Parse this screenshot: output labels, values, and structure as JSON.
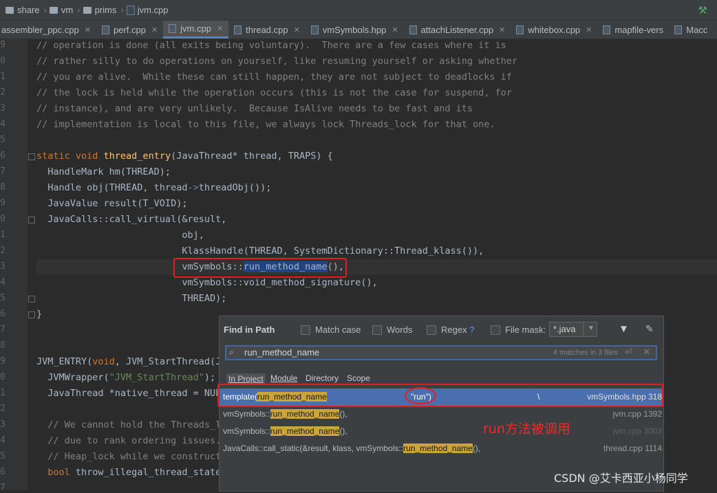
{
  "breadcrumb": {
    "items": [
      "share",
      "vm",
      "prims",
      "jvm.cpp"
    ]
  },
  "tabs": [
    {
      "label": "assembler_ppc.cpp",
      "active": false
    },
    {
      "label": "perf.cpp",
      "active": false
    },
    {
      "label": "jvm.cpp",
      "active": true
    },
    {
      "label": "thread.cpp",
      "active": false
    },
    {
      "label": "vmSymbols.hpp",
      "active": false
    },
    {
      "label": "attachListener.cpp",
      "active": false
    },
    {
      "label": "whitebox.cpp",
      "active": false
    },
    {
      "label": "mapfile-vers",
      "active": false
    },
    {
      "label": "Macc",
      "active": false
    }
  ],
  "gutter": {
    "line_numbers": [
      "9",
      "0",
      "1",
      "2",
      "3",
      "4",
      "5",
      "6",
      "7",
      "8",
      "9",
      "0",
      "1",
      "2",
      "3",
      "4",
      "5",
      "6",
      "7",
      "8",
      "9",
      "0",
      "1",
      "2",
      "3",
      "4",
      "5",
      "6",
      "7"
    ]
  },
  "code": {
    "l1": "// operation is done (all exits being voluntary).  There are a few cases where it is",
    "l2": "// rather silly to do operations on yourself, like resuming yourself or asking whether",
    "l3": "// you are alive.  While these can still happen, they are not subject to deadlocks if",
    "l4": "// the lock is held while the operation occurs (this is not the case for suspend, for",
    "l5": "// instance), and are very unlikely.  Because IsAlive needs to be fast and its",
    "l6": "// implementation is local to this file, we always lock Threads_lock for that one.",
    "l8_kw": "static void",
    "l8_fn": "thread_entry",
    "l8_rest": "(JavaThread* thread, TRAPS) {",
    "l9": "  HandleMark hm(THREAD);",
    "l10_a": "  Handle obj(THREAD, thread",
    "l10_arrow": "->",
    "l10_b": "threadObj());",
    "l11": "  JavaValue result(T_VOID);",
    "l12": "  JavaCalls::call_virtual(&result,",
    "l13": "                          obj,",
    "l14": "                          KlassHandle(THREAD, SystemDictionary::Thread_klass()),",
    "l15_a": "                          vmSymbols::",
    "l15_hl": "run_method_name",
    "l15_b": "(),",
    "l16": "                          vmSymbols::void_method_signature(),",
    "l17": "                          THREAD);",
    "l18": "}",
    "l21_a": "JVM_ENTRY(",
    "l21_kw": "void",
    "l21_b": ", JVM_StartThread(J",
    "l22_a": "  JVMWrapper(",
    "l22_str": "\"JVM_StartThread\"",
    "l22_b": ");",
    "l23": "  JavaThread *native_thread = NUL",
    "l25": "  // We cannot hold the Threads_l",
    "l26": "  // due to rank ordering issues.",
    "l27": "  // Heap_lock while we construct",
    "l28_kw": "  bool",
    "l28_rest": " throw_illegal_thread_state"
  },
  "find_panel": {
    "title": "Find in Path",
    "match_case": "Match case",
    "words": "Words",
    "regex": "Regex",
    "regex_help": "?",
    "file_mask": "File mask:",
    "file_mask_value": "*.java",
    "search_value": "run_method_name",
    "match_count": "4 matches in 3 files",
    "scopes": [
      "In Project",
      "Module",
      "Directory",
      "Scope"
    ],
    "results": [
      {
        "pre": "template(",
        "match": "run_method_name",
        "post": "",
        "extra": "\"run\")",
        "extra2": "\\",
        "loc": "vmSymbols.hpp 318",
        "selected": true
      },
      {
        "pre": "vmSymbols::",
        "match": "run_method_name",
        "post": "(),",
        "loc": "jvm.cpp 1392",
        "selected": false
      },
      {
        "pre": "vmSymbols::",
        "match": "run_method_name",
        "post": "(),",
        "loc": "jvm.cpp 3003",
        "selected": false
      },
      {
        "pre": "JavaCalls::call_static(&result, klass, vmSymbols::",
        "match": "run_method_name",
        "post": "(),",
        "loc": "thread.cpp 1114",
        "selected": false
      }
    ]
  },
  "annotation": "run方法被调用",
  "watermark": "CSDN @艾卡西亚小杨同学",
  "colors": {
    "highlight_box": "#e02020",
    "selected_row": "#4b6eaf",
    "match_bg": "#c9a53a"
  }
}
